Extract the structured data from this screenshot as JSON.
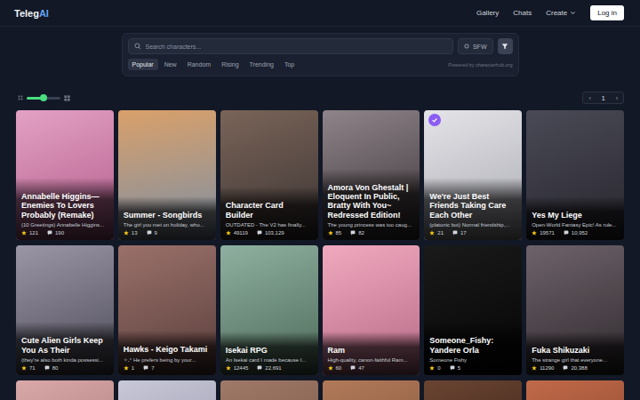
{
  "logo": {
    "text": "Teleg",
    "accent": "AI"
  },
  "nav": {
    "items": [
      {
        "label": "Gallery",
        "dropdown": false
      },
      {
        "label": "Chats",
        "dropdown": false
      },
      {
        "label": "Create",
        "dropdown": true
      }
    ],
    "login": "Log in"
  },
  "search": {
    "placeholder": "Search characters...",
    "sfw_label": "SFW"
  },
  "sort_tabs": [
    {
      "label": "Popular",
      "selected": true
    },
    {
      "label": "New",
      "selected": false
    },
    {
      "label": "Random",
      "selected": false
    },
    {
      "label": "Rising",
      "selected": false
    },
    {
      "label": "Trending",
      "selected": false
    },
    {
      "label": "Top",
      "selected": false
    }
  ],
  "powered_by": "Powered by characterhub.org",
  "card_size": {
    "level": 0.5
  },
  "pagination": {
    "prev": "‹",
    "page": "1",
    "next": "›"
  },
  "cards": [
    {
      "kind": "full",
      "title": "Annabelle Higgins—Enemies To Lovers Probably (Remake)",
      "desc": "(10 Greetings) Annabelle Higgins...",
      "stars": "121",
      "chats": "190",
      "verified": false
    },
    {
      "kind": "full",
      "title": "Summer - Songbirds",
      "desc": "The girl you met on holiday, who...",
      "stars": "13",
      "chats": "9",
      "verified": false
    },
    {
      "kind": "full",
      "title": "Character Card Builder",
      "desc": "OUTDATED - The V2 has finally...",
      "stars": "49119",
      "chats": "103,129",
      "verified": false
    },
    {
      "kind": "full",
      "title": "Amora Von Ghestalt | Eloquent In Public, Bratty With You~ Redressed Edition!",
      "desc": "The young princess was too caug...",
      "stars": "85",
      "chats": "82",
      "verified": false
    },
    {
      "kind": "full",
      "title": "We're Just Best Friends Taking Care Each Other",
      "desc": "(platonic bot) Normal friendship,...",
      "stars": "21",
      "chats": "17",
      "verified": true
    },
    {
      "kind": "full",
      "title": "Yes My Liege",
      "desc": "Open-World Fantasy Epic! As rule...",
      "stars": "19571",
      "chats": "10,952",
      "verified": false
    },
    {
      "kind": "full",
      "title": "Cute Alien Girls Keep You As Their",
      "desc": "(they're also both kinda possessi...",
      "stars": "71",
      "chats": "80",
      "verified": false
    },
    {
      "kind": "full",
      "title": "Hawks - Keigo Takami",
      "desc": "✧˖° He prefers being by your...",
      "stars": "1",
      "chats": "7",
      "verified": false
    },
    {
      "kind": "full",
      "title": "Isekai RPG",
      "desc": "An Isekai card I made because I...",
      "stars": "12445",
      "chats": "22,691",
      "verified": false
    },
    {
      "kind": "full",
      "title": "Ram",
      "desc": "High-quality, canon-faithful Ram...",
      "stars": "60",
      "chats": "47",
      "verified": false
    },
    {
      "kind": "full",
      "title": "Someone_Fishy: Yandere Orla",
      "desc": "Someone Fishy",
      "stars": "0",
      "chats": "5",
      "verified": false
    },
    {
      "kind": "full",
      "title": "Fuka Shikuzaki",
      "desc": "The strange girl that everyone...",
      "stars": "11290",
      "chats": "20,388",
      "verified": false
    },
    {
      "kind": "partial",
      "verified": false
    },
    {
      "kind": "partial",
      "verified": false
    },
    {
      "kind": "partial",
      "verified": false
    },
    {
      "kind": "partial",
      "verified": false
    },
    {
      "kind": "partial",
      "verified": false
    },
    {
      "kind": "partial",
      "verified": false
    }
  ]
}
